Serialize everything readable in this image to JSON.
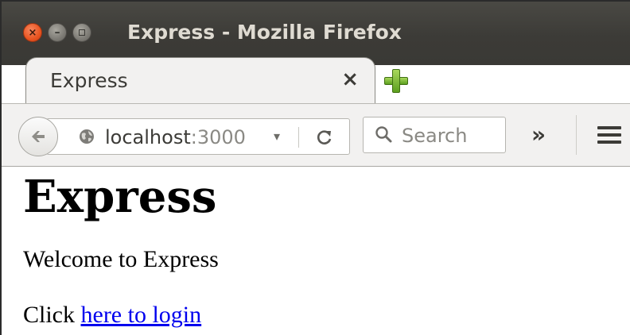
{
  "window": {
    "title": "Express - Mozilla Firefox",
    "close_glyph": "×",
    "minimize_glyph": "–"
  },
  "tab": {
    "label": "Express",
    "close_glyph": "×"
  },
  "navbar": {
    "url_host": "localhost",
    "url_port": ":3000",
    "dropdown_glyph": "▾",
    "search_placeholder": "Search",
    "overflow_glyph": "»"
  },
  "page": {
    "heading": "Express",
    "welcome": "Welcome to Express",
    "click_prefix": "Click ",
    "login_link": "here to login"
  },
  "colors": {
    "titlebar": "#3c3b37",
    "close_button": "#e95420",
    "link": "#0000ee",
    "chrome_bg": "#f2f1f0"
  },
  "icons": [
    "close-icon",
    "minimize-icon",
    "maximize-icon",
    "plus-icon",
    "back-arrow-icon",
    "globe-icon",
    "reload-icon",
    "search-icon",
    "chevron-double-right-icon",
    "hamburger-menu-icon"
  ]
}
